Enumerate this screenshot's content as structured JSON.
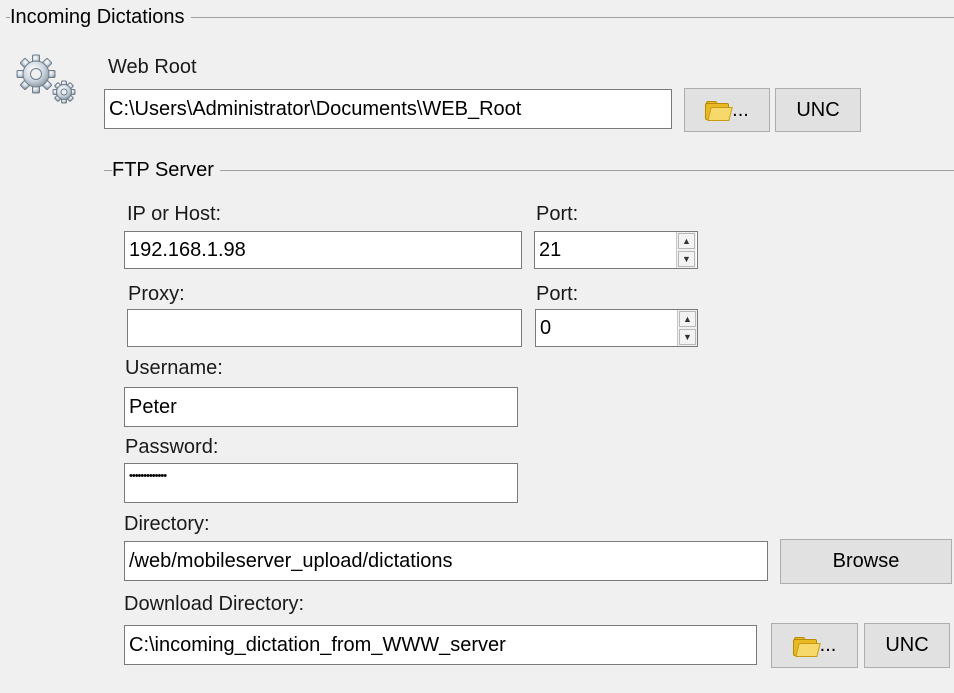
{
  "incoming_group": {
    "title": "Incoming Dictations"
  },
  "web_root": {
    "label": "Web Root",
    "value": "C:\\Users\\Administrator\\Documents\\WEB_Root",
    "browse_label": "...",
    "unc_label": "UNC"
  },
  "ftp_group": {
    "title": "FTP Server"
  },
  "ip": {
    "label": "IP or Host:",
    "value": "192.168.1.98"
  },
  "port": {
    "label": "Port:",
    "value": "21"
  },
  "proxy": {
    "label": "Proxy:",
    "value": ""
  },
  "proxy_port": {
    "label": "Port:",
    "value": "0"
  },
  "username": {
    "label": "Username:",
    "value": "Peter"
  },
  "password": {
    "label": "Password:",
    "value": "•••••••••••••"
  },
  "directory": {
    "label": "Directory:",
    "value": "/web/mobileserver_upload/dictations",
    "browse_label": "Browse"
  },
  "download_directory": {
    "label": "Download Directory:",
    "value": "C:\\incoming_dictation_from_WWW_server",
    "browse_label": "...",
    "unc_label": "UNC"
  },
  "icons": {
    "settings": "gears-icon",
    "folder": "folder-icon",
    "spin_up": "spin-up-arrow-icon",
    "spin_down": "spin-down-arrow-icon"
  }
}
